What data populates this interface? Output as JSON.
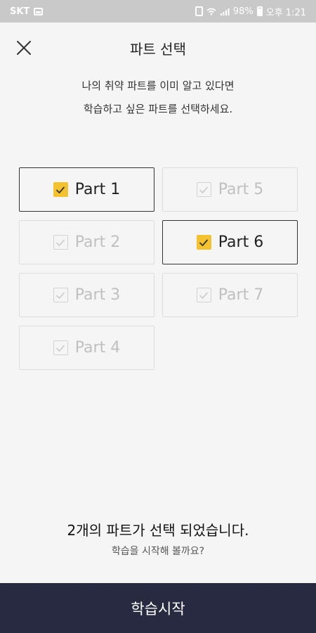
{
  "status_bar": {
    "carrier": "SKT",
    "battery": "98%",
    "time": "오후 1:21"
  },
  "header": {
    "title": "파트 선택"
  },
  "instructions": {
    "line1": "나의 취약 파트를 이미 알고 있다면",
    "line2": "학습하고 싶은 파트를 선택하세요."
  },
  "parts": [
    {
      "label": "Part 1",
      "selected": true
    },
    {
      "label": "Part 5",
      "selected": false
    },
    {
      "label": "Part 2",
      "selected": false
    },
    {
      "label": "Part 6",
      "selected": true
    },
    {
      "label": "Part 3",
      "selected": false
    },
    {
      "label": "Part 7",
      "selected": false
    },
    {
      "label": "Part 4",
      "selected": false
    }
  ],
  "summary": {
    "main": "2개의 파트가 선택 되었습니다.",
    "sub": "학습을 시작해 볼까요?"
  },
  "start_button": {
    "label": "학습시작"
  },
  "colors": {
    "accent": "#f4c22e",
    "bottom_bar": "#272a40",
    "status_bar": "#c9c9c9"
  }
}
